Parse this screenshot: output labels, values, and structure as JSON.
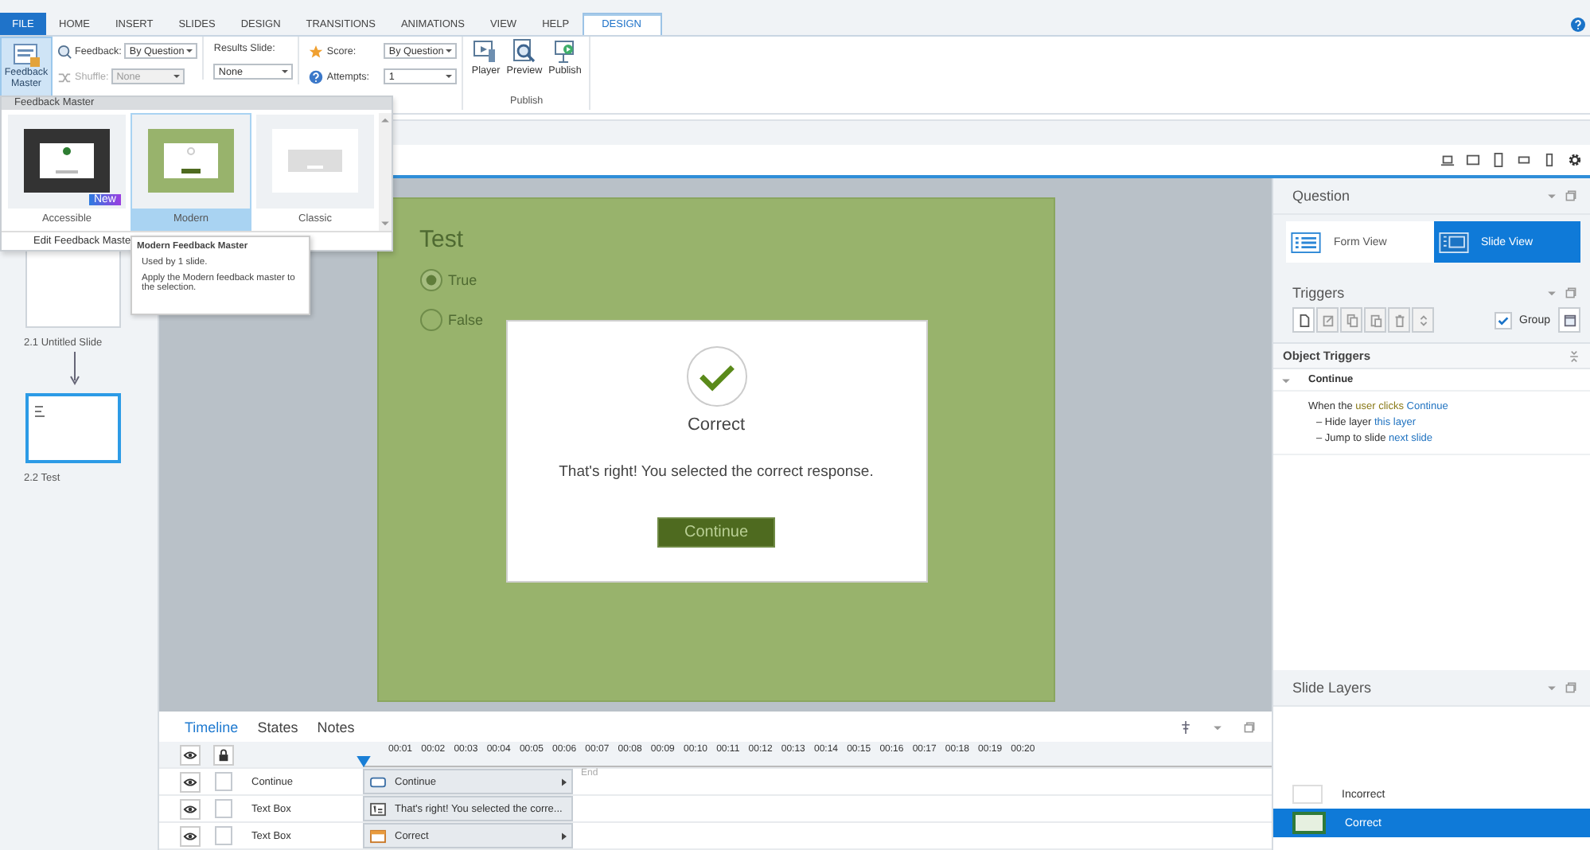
{
  "ribbon_tabs": [
    {
      "label": "FILE",
      "kind": "file",
      "selected": false
    },
    {
      "label": "HOME",
      "kind": "tab",
      "selected": false
    },
    {
      "label": "INSERT",
      "kind": "tab",
      "selected": false
    },
    {
      "label": "SLIDES",
      "kind": "tab",
      "selected": false
    },
    {
      "label": "DESIGN",
      "kind": "tab",
      "selected": false
    },
    {
      "label": "TRANSITIONS",
      "kind": "tab",
      "selected": false
    },
    {
      "label": "ANIMATIONS",
      "kind": "tab",
      "selected": false
    },
    {
      "label": "VIEW",
      "kind": "tab",
      "selected": false
    },
    {
      "label": "HELP",
      "kind": "tab",
      "selected": false
    },
    {
      "label": "DESIGN",
      "kind": "context",
      "selected": true
    }
  ],
  "ribbon": {
    "feedback_master": "Feedback Master",
    "feedback": {
      "label": "Feedback:",
      "value": "By Question"
    },
    "shuffle": {
      "label": "Shuffle:",
      "value": "None",
      "disabled": true
    },
    "results_slide": {
      "label": "Results Slide:",
      "value": "None"
    },
    "score": {
      "label": "Score:",
      "value": "By Question"
    },
    "attempts": {
      "label": "Attempts:",
      "value": "1"
    },
    "publish_buttons": [
      {
        "label": "Player",
        "kind": "player"
      },
      {
        "label": "Preview",
        "kind": "preview"
      },
      {
        "label": "Publish",
        "kind": "publish"
      }
    ],
    "publish_group": "Publish"
  },
  "feedback_master_menu": {
    "header": "Feedback Master",
    "items": [
      {
        "label": "Accessible",
        "kind": "dark",
        "badge": "New",
        "selected": false
      },
      {
        "label": "Modern",
        "kind": "green",
        "selected": true
      },
      {
        "label": "Classic",
        "kind": "gray",
        "selected": false
      }
    ],
    "edit_link": "Edit Feedback Maste"
  },
  "tooltip": {
    "title": "Modern Feedback Master",
    "lines": [
      "Used by 1 slide.",
      "Apply the Modern feedback master to the selection."
    ]
  },
  "slides": [
    {
      "label": "2.1 Untitled Slide",
      "selected": false
    },
    {
      "label": "2.2 Test",
      "selected": true
    }
  ],
  "slide": {
    "title": "Test",
    "options": [
      {
        "label": "True",
        "selected": true
      },
      {
        "label": "False",
        "selected": false
      }
    ],
    "feedback": {
      "heading": "Correct",
      "message": "That's right!  You selected the correct response.",
      "button": "Continue"
    }
  },
  "question_panel": {
    "title": "Question",
    "views": [
      {
        "label": "Form View",
        "kind": "form",
        "selected": false
      },
      {
        "label": "Slide View",
        "kind": "slide",
        "selected": true
      }
    ]
  },
  "triggers": {
    "title": "Triggers",
    "group": {
      "label": "Group",
      "checked": true
    },
    "section": "Object Triggers",
    "object": "Continue",
    "lines": [
      {
        "kind": "event",
        "prefix": "When the",
        "event": "user clicks",
        "target": "Continue"
      },
      {
        "kind": "action",
        "prefix": "– Hide layer",
        "target": "this layer"
      },
      {
        "kind": "action",
        "prefix": "– Jump to slide",
        "target": "next slide"
      }
    ]
  },
  "slide_layers": {
    "title": "Slide Layers",
    "layers": [
      {
        "label": "Incorrect",
        "selected": false
      },
      {
        "label": "Correct",
        "selected": true
      }
    ]
  },
  "timeline": {
    "tabs": [
      {
        "label": "Timeline",
        "selected": true
      },
      {
        "label": "States",
        "selected": false
      },
      {
        "label": "Notes",
        "selected": false
      }
    ],
    "ticks": [
      "00:01",
      "00:02",
      "00:03",
      "00:04",
      "00:05",
      "00:06",
      "00:07",
      "00:08",
      "00:09",
      "00:10",
      "00:11",
      "00:12",
      "00:13",
      "00:14",
      "00:15",
      "00:16",
      "00:17",
      "00:18",
      "00:19",
      "00:20"
    ],
    "end_label": "End",
    "rows": [
      {
        "name": "Continue",
        "bar": "Continue",
        "kind": "button",
        "locked": false
      },
      {
        "name": "Text Box",
        "bar": "That's right! You selected the corre...",
        "kind": "text",
        "locked": false
      },
      {
        "name": "Text Box",
        "bar": "Correct",
        "kind": "shape",
        "locked": false
      }
    ]
  }
}
